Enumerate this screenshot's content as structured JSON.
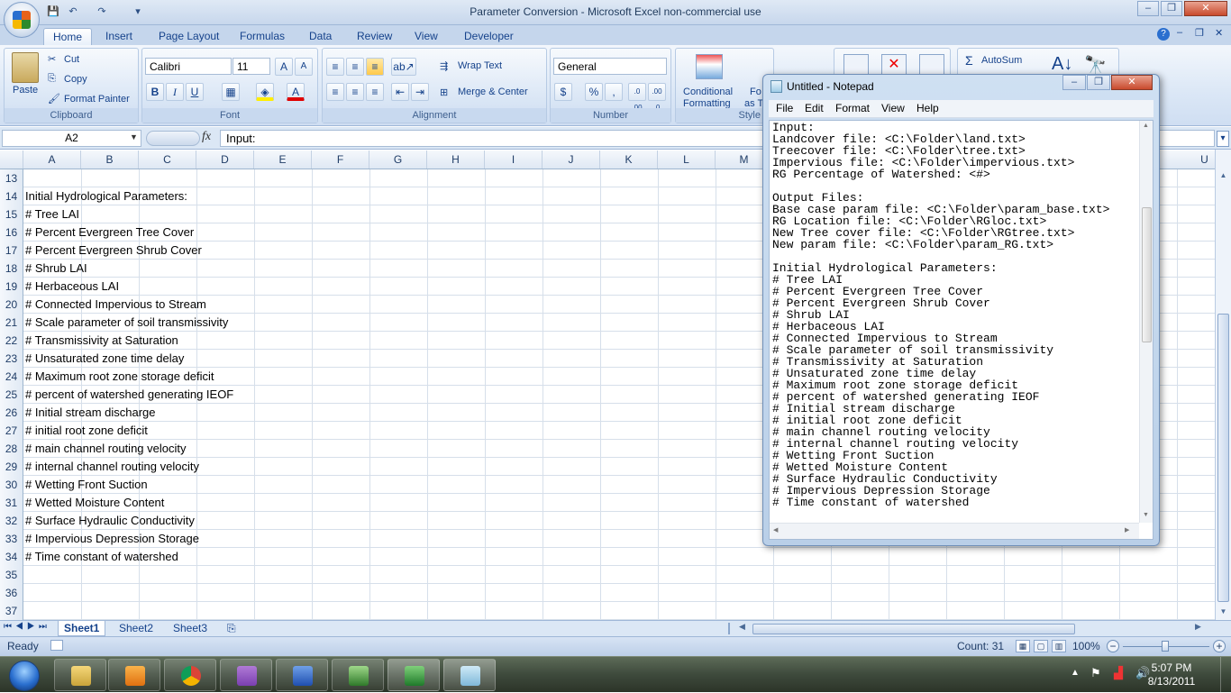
{
  "window": {
    "title": "Parameter Conversion - Microsoft Excel non-commercial use",
    "controls": [
      "–",
      "❐",
      "✕"
    ],
    "inner_controls": [
      "–",
      "❐",
      "✕"
    ]
  },
  "quick_access": {
    "save_icon": "save-icon",
    "undo_icon": "undo-icon",
    "redo_icon": "redo-icon"
  },
  "ribbon": {
    "tabs": [
      "Home",
      "Insert",
      "Page Layout",
      "Formulas",
      "Data",
      "Review",
      "View",
      "Developer"
    ],
    "active_tab": "Home",
    "clipboard": {
      "paste": "Paste",
      "cut": "Cut",
      "copy": "Copy",
      "format_painter": "Format Painter",
      "label": "Clipboard"
    },
    "font": {
      "name": "Calibri",
      "size": "11",
      "bold": "B",
      "italic": "I",
      "underline": "U",
      "label": "Font"
    },
    "alignment": {
      "wrap_text": "Wrap Text",
      "merge_center": "Merge & Center",
      "label": "Alignment"
    },
    "number": {
      "format": "General",
      "currency": "$",
      "percent": "%",
      "comma": ",",
      "inc_decimal": ".0 .00",
      "dec_decimal": ".00 .0",
      "label": "Number"
    },
    "styles": {
      "conditional": "Conditional",
      "formatting": "Formatting",
      "format_as": "Fo",
      "as_t": "as T",
      "label": "Style"
    },
    "editing": {
      "autosum": "AutoSum"
    }
  },
  "formula_bar": {
    "name_box": "A2",
    "fx": "fx",
    "value": "Input:"
  },
  "columns": [
    "A",
    "B",
    "C",
    "D",
    "E",
    "F",
    "G",
    "H",
    "I",
    "J",
    "K",
    "L",
    "M",
    "U"
  ],
  "rows": [
    {
      "num": "13",
      "text": ""
    },
    {
      "num": "14",
      "text": "Initial Hydrological Parameters:"
    },
    {
      "num": "15",
      "text": "# Tree LAI"
    },
    {
      "num": "16",
      "text": "# Percent Evergreen Tree Cover"
    },
    {
      "num": "17",
      "text": "# Percent Evergreen Shrub Cover"
    },
    {
      "num": "18",
      "text": "# Shrub LAI"
    },
    {
      "num": "19",
      "text": "# Herbaceous LAI"
    },
    {
      "num": "20",
      "text": "# Connected Impervious to Stream"
    },
    {
      "num": "21",
      "text": "# Scale parameter of soil transmissivity"
    },
    {
      "num": "22",
      "text": "# Transmissivity at Saturation"
    },
    {
      "num": "23",
      "text": "# Unsaturated zone time delay"
    },
    {
      "num": "24",
      "text": "# Maximum root zone storage deficit"
    },
    {
      "num": "25",
      "text": "# percent of watershed generating IEOF"
    },
    {
      "num": "26",
      "text": "# Initial stream discharge"
    },
    {
      "num": "27",
      "text": "# initial root zone deficit"
    },
    {
      "num": "28",
      "text": "# main channel routing velocity"
    },
    {
      "num": "29",
      "text": "# internal channel routing velocity"
    },
    {
      "num": "30",
      "text": "# Wetting Front Suction"
    },
    {
      "num": "31",
      "text": "# Wetted Moisture Content"
    },
    {
      "num": "32",
      "text": "# Surface Hydraulic Conductivity"
    },
    {
      "num": "33",
      "text": "# Impervious Depression Storage"
    },
    {
      "num": "34",
      "text": "# Time constant of watershed"
    },
    {
      "num": "35",
      "text": ""
    },
    {
      "num": "36",
      "text": ""
    },
    {
      "num": "37",
      "text": ""
    }
  ],
  "sheets": [
    "Sheet1",
    "Sheet2",
    "Sheet3"
  ],
  "active_sheet": "Sheet1",
  "status": {
    "ready": "Ready",
    "count": "Count: 31",
    "zoom": "100%"
  },
  "notepad": {
    "title": "Untitled - Notepad",
    "menu": [
      "File",
      "Edit",
      "Format",
      "View",
      "Help"
    ],
    "text": "Input:\nLandcover file: <C:\\Folder\\land.txt>\nTreecover file: <C:\\Folder\\tree.txt>\nImpervious file: <C:\\Folder\\impervious.txt>\nRG Percentage of Watershed: <#>\n\nOutput Files:\nBase case param file: <C:\\Folder\\param_base.txt>\nRG Location file: <C:\\Folder\\RGloc.txt>\nNew Tree cover file: <C:\\Folder\\RGtree.txt>\nNew param file: <C:\\Folder\\param_RG.txt>\n\nInitial Hydrological Parameters:\n# Tree LAI\n# Percent Evergreen Tree Cover\n# Percent Evergreen Shrub Cover\n# Shrub LAI\n# Herbaceous LAI\n# Connected Impervious to Stream\n# Scale parameter of soil transmissivity\n# Transmissivity at Saturation\n# Unsaturated zone time delay\n# Maximum root zone storage deficit\n# percent of watershed generating IEOF\n# Initial stream discharge\n# initial root zone deficit\n# main channel routing velocity\n# internal channel routing velocity\n# Wetting Front Suction\n# Wetted Moisture Content\n# Surface Hydraulic Conductivity\n# Impervious Depression Storage\n# Time constant of watershed"
  },
  "taskbar": {
    "time": "5:07 PM",
    "date": "8/13/2011"
  }
}
